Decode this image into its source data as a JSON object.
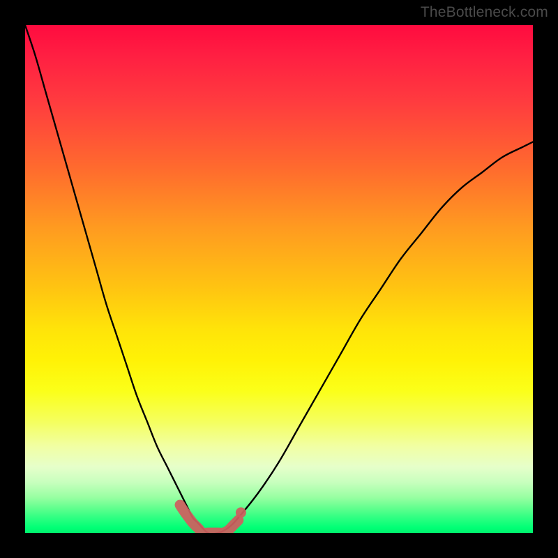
{
  "watermark": "TheBottleneck.com",
  "chart_data": {
    "type": "line",
    "title": "",
    "xlabel": "",
    "ylabel": "",
    "xlim": [
      0,
      100
    ],
    "ylim": [
      0,
      100
    ],
    "grid": false,
    "legend": false,
    "series": [
      {
        "name": "bottleneck-curve",
        "color": "#000000",
        "x": [
          0,
          2,
          4,
          6,
          8,
          10,
          12,
          14,
          16,
          18,
          20,
          22,
          24,
          26,
          28,
          30,
          32,
          33,
          34,
          36,
          38,
          40,
          42,
          46,
          50,
          54,
          58,
          62,
          66,
          70,
          74,
          78,
          82,
          86,
          90,
          94,
          98,
          100
        ],
        "values": [
          100,
          94,
          87,
          80,
          73,
          66,
          59,
          52,
          45,
          39,
          33,
          27,
          22,
          17,
          13,
          9,
          5,
          3,
          2,
          0,
          0,
          1,
          3,
          8,
          14,
          21,
          28,
          35,
          42,
          48,
          54,
          59,
          64,
          68,
          71,
          74,
          76,
          77
        ]
      },
      {
        "name": "highlight-band",
        "color": "#d06464",
        "x": [
          30.5,
          31.5,
          33,
          34,
          35,
          36,
          37,
          38,
          39,
          40,
          41,
          42,
          42.5
        ],
        "values": [
          5.5,
          4,
          2,
          1,
          0,
          0,
          0,
          0,
          0,
          0.5,
          1.5,
          2.5,
          4
        ]
      }
    ],
    "gradient_stops": [
      {
        "pos": 0,
        "color": "#ff0b3f"
      },
      {
        "pos": 15,
        "color": "#ff3b3f"
      },
      {
        "pos": 40,
        "color": "#ff9b20"
      },
      {
        "pos": 60,
        "color": "#ffe409"
      },
      {
        "pos": 78,
        "color": "#f5ff5d"
      },
      {
        "pos": 90,
        "color": "#c8ffbe"
      },
      {
        "pos": 99,
        "color": "#00ff75"
      }
    ]
  }
}
